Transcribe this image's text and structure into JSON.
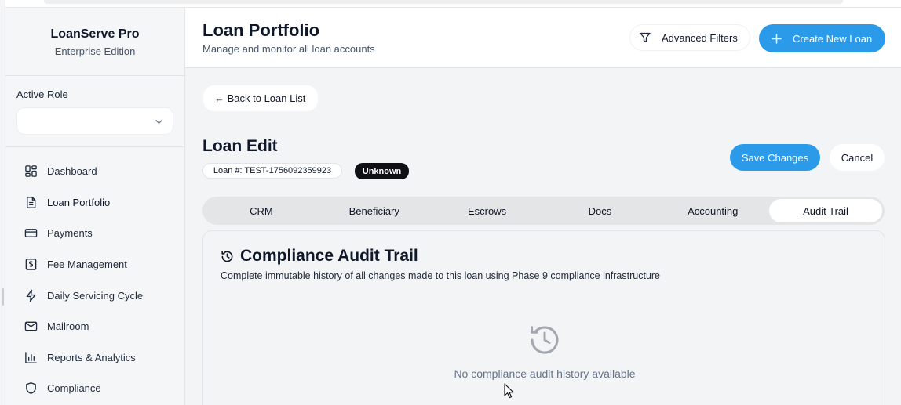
{
  "app": {
    "name": "LoanServe Pro",
    "edition": "Enterprise Edition"
  },
  "role": {
    "label": "Active Role",
    "value": ""
  },
  "sidebar": {
    "items": [
      {
        "label": "Dashboard",
        "icon": "dashboard-icon"
      },
      {
        "label": "Loan Portfolio",
        "icon": "document-icon",
        "active": true
      },
      {
        "label": "Payments",
        "icon": "credit-card-icon"
      },
      {
        "label": "Fee Management",
        "icon": "dollar-receipt-icon"
      },
      {
        "label": "Daily Servicing Cycle",
        "icon": "lightning-icon"
      },
      {
        "label": "Mailroom",
        "icon": "mail-icon"
      },
      {
        "label": "Reports & Analytics",
        "icon": "bar-chart-icon"
      },
      {
        "label": "Compliance",
        "icon": "shield-icon"
      }
    ]
  },
  "header": {
    "title": "Loan Portfolio",
    "subtitle": "Manage and monitor all loan accounts",
    "filters_label": "Advanced Filters",
    "create_label": "Create New Loan"
  },
  "main": {
    "back_label": "← Back to Loan List",
    "edit_title": "Loan Edit",
    "loan_number": "Loan #: TEST-1756092359923",
    "status": "Unknown",
    "save_label": "Save Changes",
    "cancel_label": "Cancel",
    "tabs": [
      {
        "label": "CRM"
      },
      {
        "label": "Beneficiary"
      },
      {
        "label": "Escrows"
      },
      {
        "label": "Docs"
      },
      {
        "label": "Accounting"
      },
      {
        "label": "Audit Trail",
        "active": true
      }
    ],
    "panel": {
      "title": "Compliance Audit Trail",
      "description": "Complete immutable history of all changes made to this loan using Phase 9 compliance infrastructure",
      "empty_text": "No compliance audit history available"
    }
  },
  "colors": {
    "accent": "#2b9be9",
    "badge_dark": "#0f0f14",
    "tab_track": "#e4e5e7"
  }
}
